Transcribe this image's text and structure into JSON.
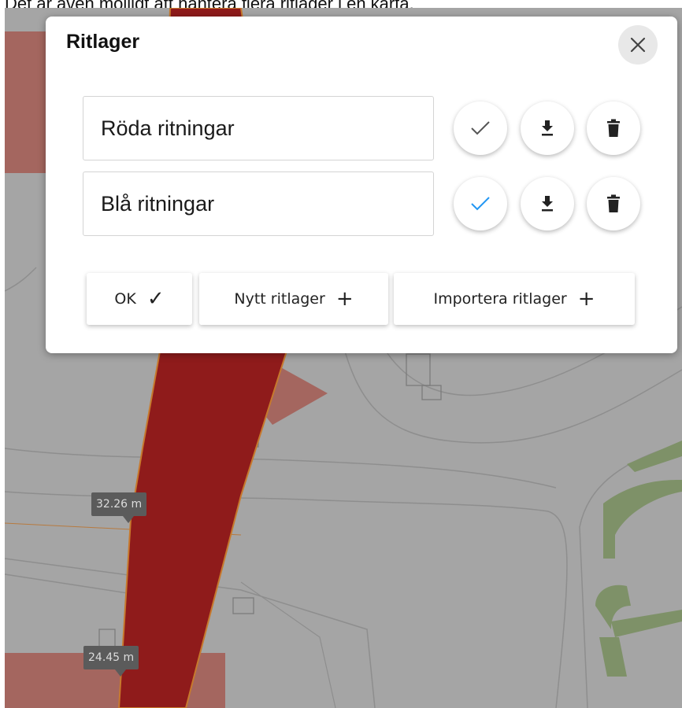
{
  "caption": "Det är även möjligt att hantera flera ritlager i en karta.",
  "dialog": {
    "title": "Ritlager",
    "close_icon": "close-icon",
    "layers": [
      {
        "name": "Röda ritningar",
        "active": false,
        "check_color": "#555555"
      },
      {
        "name": "Blå ritningar",
        "active": true,
        "check_color": "#2196f3"
      }
    ],
    "buttons": {
      "ok_label": "OK",
      "ok_glyph": "✓",
      "new_label": "Nytt ritlager",
      "new_glyph": "+",
      "import_label": "Importera ritlager",
      "import_glyph": "+"
    }
  },
  "map": {
    "measurements": [
      "32.26 m",
      "24.45 m"
    ],
    "colors": {
      "background": "#a5a5a5",
      "road": "#8f1b1b",
      "road_outline": "#c7792d",
      "building": "#a4665f",
      "grass": "#7e9168"
    }
  }
}
